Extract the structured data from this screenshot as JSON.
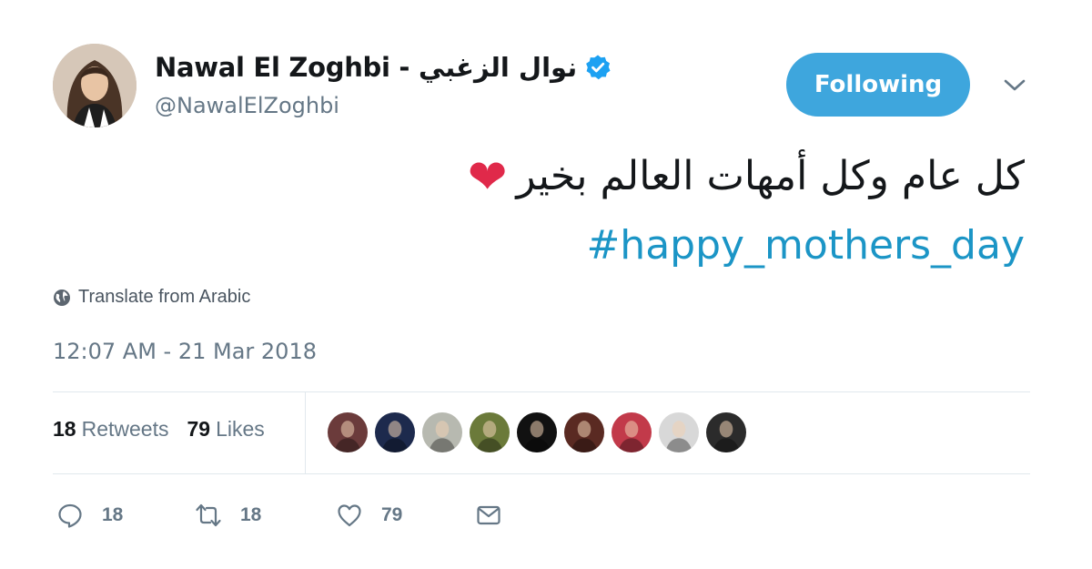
{
  "author": {
    "display_name": "Nawal El Zoghbi - نوال الزغبي",
    "handle": "@NawalElZoghbi",
    "verified": true,
    "avatar_icon": "profile-photo"
  },
  "follow_button": {
    "label": "Following",
    "color": "#3ea6dd"
  },
  "menu_icon": "chevron-down-icon",
  "tweet": {
    "text": "كل عام وكل أمهات العالم بخير",
    "emoji": "❤",
    "hashtag": "#happy_mothers_day",
    "hashtag_color": "#1b95c6"
  },
  "translate": {
    "icon": "globe-icon",
    "label": "Translate from Arabic"
  },
  "timestamp": "12:07 AM - 21 Mar 2018",
  "stats": {
    "retweets_count": "18",
    "retweets_label": "Retweets",
    "likes_count": "79",
    "likes_label": "Likes"
  },
  "likers": [
    {
      "color": "#6b3b3b"
    },
    {
      "color": "#1d2a4d"
    },
    {
      "color": "#b7b9b0"
    },
    {
      "color": "#6b7a3a"
    },
    {
      "color": "#111111"
    },
    {
      "color": "#5a2a22"
    },
    {
      "color": "#c23a4a"
    },
    {
      "color": "#d8d8d8"
    },
    {
      "color": "#2b2b2b"
    }
  ],
  "actions": {
    "reply_count": "18",
    "retweet_count": "18",
    "like_count": "79"
  }
}
